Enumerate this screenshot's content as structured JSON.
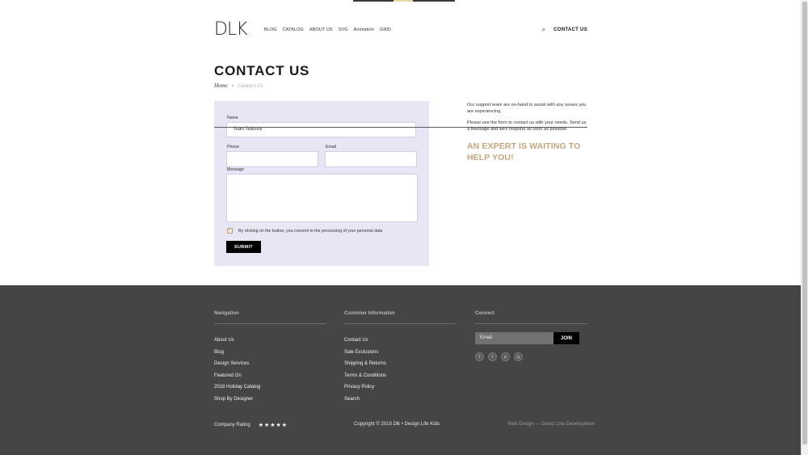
{
  "header": {
    "logo": "DLK",
    "nav": [
      "BLOG",
      "CATALOG",
      "ABOUT US",
      "SVG",
      "Animation",
      "GRID"
    ],
    "contact_label": "CONTACT US",
    "search_icon": "search-icon"
  },
  "page": {
    "title": "CONTACT US",
    "breadcrumb_home": "Home",
    "breadcrumb_current": "Contact Us"
  },
  "form": {
    "name_label": "Name",
    "name_value": "Ivan Ivanov",
    "phone_label": "Phone",
    "email_label": "Email",
    "message_label": "Message",
    "consent_text": "By clicking on the button, you consent to the processing of your personal data",
    "consent_checked": true,
    "submit_label": "SUBMIT",
    "panel_color": "#e6e6f5"
  },
  "info": {
    "p1": "Our support team are on-hand to assist with any issues you are experiencing.",
    "p2": "Please use the form to contact us with your needs. Send us a message and we'll respond as soon as possible.",
    "cta": "AN EXPERT IS WAITING TO HELP YOU!",
    "accent": "#c8a67d"
  },
  "footer": {
    "nav_title": "Navigation",
    "nav_items": [
      "About Us",
      "Blog",
      "Design Services",
      "Featured On",
      "2018 Holiday Catalog",
      "Shop By Designer"
    ],
    "ci_title": "Customer Information",
    "ci_items": [
      "Contact Us",
      "Sale Exclusions",
      "Shipping & Returns",
      "Terms & Conditions",
      "Privacy Policy",
      "Search"
    ],
    "connect_title": "Connect",
    "email_placeholder": "Email",
    "join_label": "JOIN",
    "socials": [
      "facebook-icon",
      "twitter-icon",
      "pinterest-icon",
      "instagram-icon"
    ],
    "rating_label": "Company Rating",
    "stars": "★★★★★",
    "copyright": "Copyright © 2018 Dlk • Design Life Kids",
    "credit": "Web Design — Direct Line Development",
    "bg": "#454545"
  }
}
